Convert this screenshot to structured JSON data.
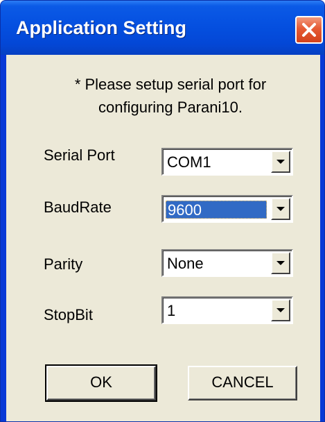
{
  "window": {
    "title": "Application Setting",
    "close_icon": "close-icon",
    "close_color": "#e0512a",
    "titlebar_color": "#0550e0"
  },
  "instruction": {
    "line1": "* Please setup serial port for",
    "line2": "configuring Parani10."
  },
  "fields": [
    {
      "label": "Serial Port",
      "value": "COM1"
    },
    {
      "label": "BaudRate",
      "value": "9600"
    },
    {
      "label": "Parity",
      "value": "None"
    },
    {
      "label": "StopBit",
      "value": "1"
    }
  ],
  "buttons": {
    "ok_label": "OK",
    "cancel_label": "CANCEL"
  },
  "colors": {
    "dialog_background": "#ece9d8",
    "selection": "#316ac5"
  }
}
